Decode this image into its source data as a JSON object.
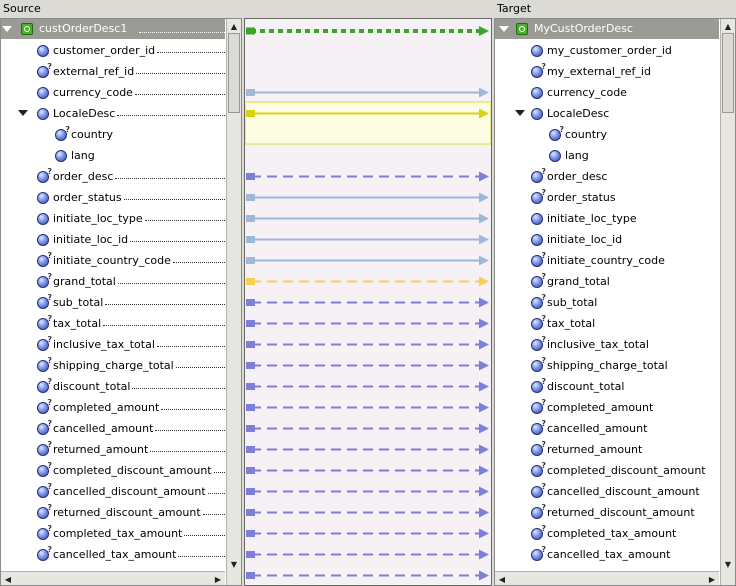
{
  "source": {
    "header": "Source",
    "root": "custOrderDesc1",
    "items": [
      {
        "label": "customer_order_id",
        "icon": "element",
        "q": false
      },
      {
        "label": "external_ref_id",
        "icon": "element",
        "q": true
      },
      {
        "label": "currency_code",
        "icon": "element",
        "q": false
      },
      {
        "label": "LocaleDesc",
        "icon": "element",
        "q": false,
        "expanded": true
      },
      {
        "label": "country",
        "icon": "element",
        "q": true,
        "child": true
      },
      {
        "label": "lang",
        "icon": "element",
        "q": false,
        "child": true
      },
      {
        "label": "order_desc",
        "icon": "element",
        "q": true
      },
      {
        "label": "order_status",
        "icon": "element",
        "q": false
      },
      {
        "label": "initiate_loc_type",
        "icon": "element",
        "q": false
      },
      {
        "label": "initiate_loc_id",
        "icon": "element",
        "q": false
      },
      {
        "label": "initiate_country_code",
        "icon": "element",
        "q": true
      },
      {
        "label": "grand_total",
        "icon": "element",
        "q": true
      },
      {
        "label": "sub_total",
        "icon": "element",
        "q": true
      },
      {
        "label": "tax_total",
        "icon": "element",
        "q": true
      },
      {
        "label": "inclusive_tax_total",
        "icon": "element",
        "q": true
      },
      {
        "label": "shipping_charge_total",
        "icon": "element",
        "q": true
      },
      {
        "label": "discount_total",
        "icon": "element",
        "q": true
      },
      {
        "label": "completed_amount",
        "icon": "element",
        "q": true
      },
      {
        "label": "cancelled_amount",
        "icon": "element",
        "q": true
      },
      {
        "label": "returned_amount",
        "icon": "element",
        "q": true
      },
      {
        "label": "completed_discount_amount",
        "icon": "element",
        "q": true
      },
      {
        "label": "cancelled_discount_amount",
        "icon": "element",
        "q": true
      },
      {
        "label": "returned_discount_amount",
        "icon": "element",
        "q": true
      },
      {
        "label": "completed_tax_amount",
        "icon": "element",
        "q": true
      },
      {
        "label": "cancelled_tax_amount",
        "icon": "element",
        "q": true
      }
    ]
  },
  "target": {
    "header": "Target",
    "root": "MyCustOrderDesc",
    "items": [
      {
        "label": "my_customer_order_id",
        "icon": "element",
        "q": false
      },
      {
        "label": "my_external_ref_id",
        "icon": "element",
        "q": true
      },
      {
        "label": "currency_code",
        "icon": "element",
        "q": false
      },
      {
        "label": "LocaleDesc",
        "icon": "element",
        "q": false,
        "expanded": true
      },
      {
        "label": "country",
        "icon": "element",
        "q": true,
        "child": true
      },
      {
        "label": "lang",
        "icon": "element",
        "q": false,
        "child": true
      },
      {
        "label": "order_desc",
        "icon": "element",
        "q": true
      },
      {
        "label": "order_status",
        "icon": "element",
        "q": true
      },
      {
        "label": "initiate_loc_type",
        "icon": "element",
        "q": false
      },
      {
        "label": "initiate_loc_id",
        "icon": "element",
        "q": false
      },
      {
        "label": "initiate_country_code",
        "icon": "element",
        "q": true
      },
      {
        "label": "grand_total",
        "icon": "element",
        "q": true
      },
      {
        "label": "sub_total",
        "icon": "element",
        "q": true
      },
      {
        "label": "tax_total",
        "icon": "element",
        "q": true
      },
      {
        "label": "inclusive_tax_total",
        "icon": "element",
        "q": true
      },
      {
        "label": "shipping_charge_total",
        "icon": "element",
        "q": true
      },
      {
        "label": "discount_total",
        "icon": "element",
        "q": true
      },
      {
        "label": "completed_amount",
        "icon": "element",
        "q": true
      },
      {
        "label": "cancelled_amount",
        "icon": "element",
        "q": true
      },
      {
        "label": "returned_amount",
        "icon": "element",
        "q": true
      },
      {
        "label": "completed_discount_amount",
        "icon": "element",
        "q": true
      },
      {
        "label": "cancelled_discount_amount",
        "icon": "element",
        "q": true
      },
      {
        "label": "returned_discount_amount",
        "icon": "element",
        "q": true
      },
      {
        "label": "completed_tax_amount",
        "icon": "element",
        "q": true
      },
      {
        "label": "cancelled_tax_amount",
        "icon": "element",
        "q": true
      }
    ]
  },
  "mappings": [
    {
      "row": "root",
      "style": "root-dotted",
      "color": "#3aa52a"
    },
    {
      "row": 2,
      "style": "solid",
      "color": "#a0b7d8"
    },
    {
      "row": 3,
      "style": "solid",
      "color": "#d6d21a"
    },
    {
      "row": 6,
      "style": "dashed",
      "color": "#7d80d6"
    },
    {
      "row": 7,
      "style": "solid",
      "color": "#a0b7d8"
    },
    {
      "row": 8,
      "style": "solid",
      "color": "#a0b7d8"
    },
    {
      "row": 9,
      "style": "solid",
      "color": "#a0b7d8"
    },
    {
      "row": 10,
      "style": "solid",
      "color": "#a0b7d8"
    },
    {
      "row": 11,
      "style": "dashed",
      "color": "#f6cf59"
    },
    {
      "row": 12,
      "style": "dashed",
      "color": "#7d80d6"
    },
    {
      "row": 13,
      "style": "dashed",
      "color": "#7d80d6"
    },
    {
      "row": 14,
      "style": "dashed",
      "color": "#7d80d6"
    },
    {
      "row": 15,
      "style": "dashed",
      "color": "#7d80d6"
    },
    {
      "row": 16,
      "style": "dashed",
      "color": "#7d80d6"
    },
    {
      "row": 17,
      "style": "dashed",
      "color": "#7d80d6"
    },
    {
      "row": 18,
      "style": "dashed",
      "color": "#7d80d6"
    },
    {
      "row": 19,
      "style": "dashed",
      "color": "#7d80d6"
    },
    {
      "row": 20,
      "style": "dashed",
      "color": "#7d80d6"
    },
    {
      "row": 21,
      "style": "dashed",
      "color": "#7d80d6"
    },
    {
      "row": 22,
      "style": "dashed",
      "color": "#7d80d6"
    },
    {
      "row": 23,
      "style": "dashed",
      "color": "#7d80d6"
    },
    {
      "row": 24,
      "style": "dashed",
      "color": "#7d80d6"
    },
    {
      "row": 25,
      "style": "dashed",
      "color": "#7d80d6"
    }
  ],
  "colors": {
    "canvas": "#f5f1f5",
    "locale_band": "#fcfce0",
    "locale_band_border": "#e3e05a",
    "root_row": "#9c9a94"
  }
}
